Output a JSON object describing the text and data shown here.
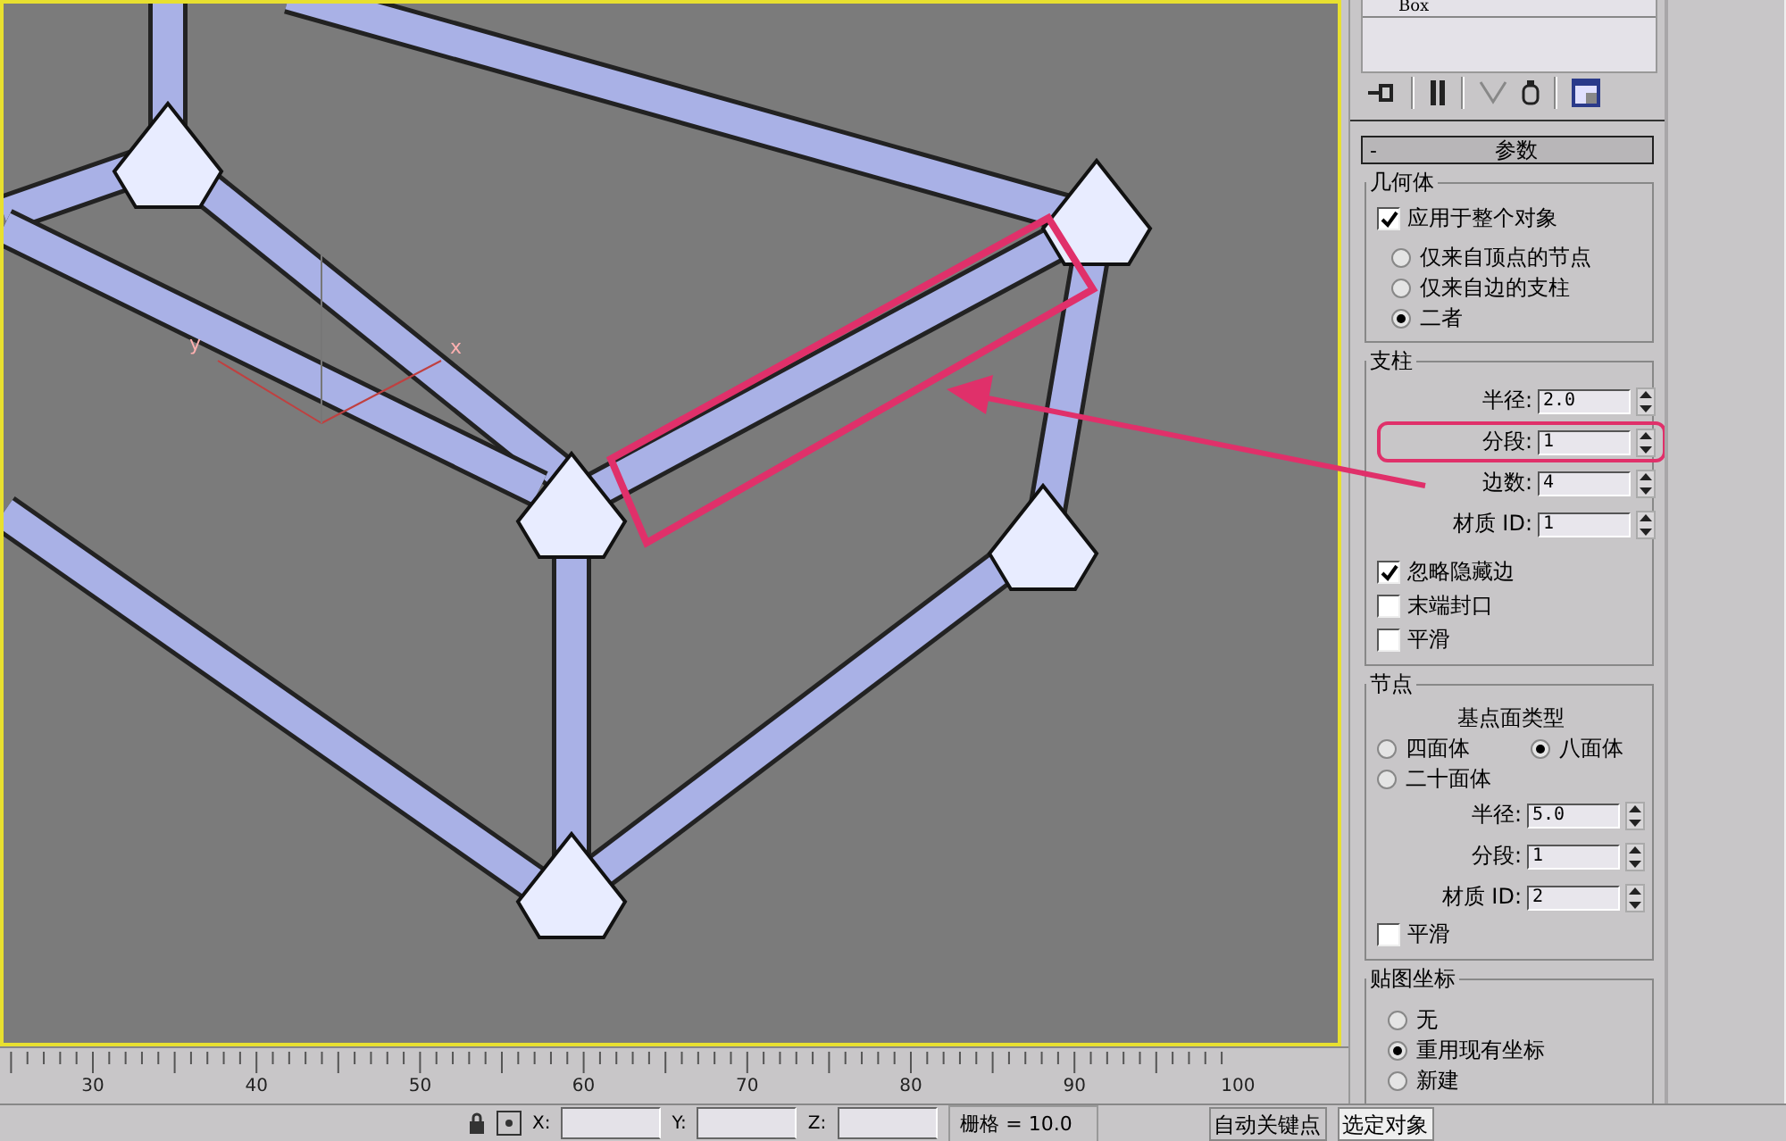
{
  "viewport": {
    "axis_labels": [
      "y",
      "x"
    ],
    "highlight": true
  },
  "modifier_stack": {
    "items": [
      "Box"
    ]
  },
  "rollout": {
    "collapse_symbol": "-",
    "title": "参数"
  },
  "geometry": {
    "title": "几何体",
    "apply_to_whole": {
      "label": "应用于整个对象",
      "checked": true
    },
    "options": [
      {
        "label": "仅来自顶点的节点",
        "selected": false
      },
      {
        "label": "仅来自边的支柱",
        "selected": false
      },
      {
        "label": "二者",
        "selected": true
      }
    ]
  },
  "struts": {
    "title": "支柱",
    "fields": [
      {
        "label": "半径:",
        "value": "2.0",
        "highlighted": false
      },
      {
        "label": "分段:",
        "value": "1",
        "highlighted": true
      },
      {
        "label": "边数:",
        "value": "4",
        "highlighted": false
      },
      {
        "label": "材质 ID:",
        "value": "1",
        "highlighted": false
      }
    ],
    "checkboxes": [
      {
        "label": "忽略隐藏边",
        "checked": true
      },
      {
        "label": "末端封口",
        "checked": false
      },
      {
        "label": "平滑",
        "checked": false
      }
    ]
  },
  "joints": {
    "title": "节点",
    "type_title": "基点面类型",
    "types": [
      {
        "label": "四面体",
        "selected": false
      },
      {
        "label": "八面体",
        "selected": true
      },
      {
        "label": "二十面体",
        "selected": false
      }
    ],
    "fields": [
      {
        "label": "半径:",
        "value": "5.0"
      },
      {
        "label": "分段:",
        "value": "1"
      },
      {
        "label": "材质 ID:",
        "value": "2"
      }
    ],
    "checkboxes": [
      {
        "label": "平滑",
        "checked": false
      }
    ]
  },
  "mapping": {
    "title": "贴图坐标",
    "options": [
      {
        "label": "无",
        "selected": false
      },
      {
        "label": "重用现有坐标",
        "selected": true
      },
      {
        "label": "新建",
        "selected": false
      }
    ]
  },
  "timeline": {
    "ticks": [
      "30",
      "40",
      "50",
      "60",
      "70",
      "80",
      "90",
      "100"
    ]
  },
  "status_bar": {
    "x_label": "X:",
    "y_label": "Y:",
    "z_label": "Z:",
    "grid": "栅格 = 10.0",
    "auto_key": "自动关键点",
    "selection": "选定对象"
  }
}
